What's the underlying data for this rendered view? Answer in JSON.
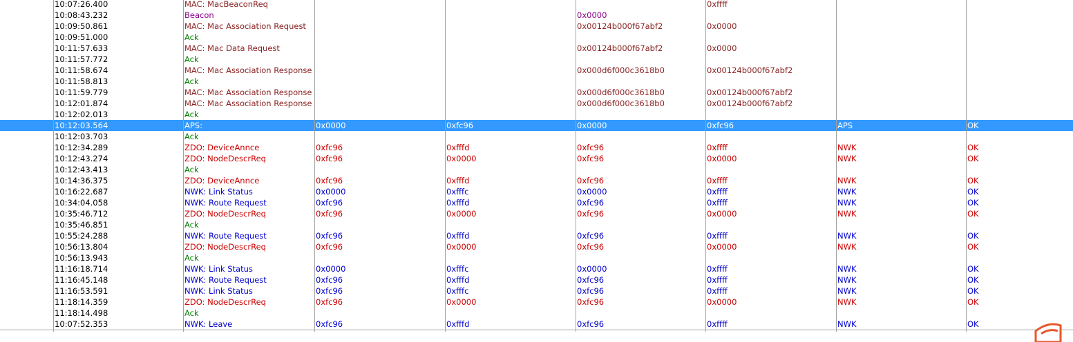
{
  "colors": {
    "MAC": "#8b2323",
    "Beacon": "#8b008b",
    "Ack": "#008000",
    "ZDO": "#cc0000",
    "NWK": "#0000cc",
    "APS": "#ffffff",
    "selected_bg": "#3399ff"
  },
  "rows": [
    {
      "time": "10:07:26.400",
      "type": "MAC",
      "desc": "MAC: MacBeaconReq",
      "src": "",
      "dst": "",
      "mac_src": "",
      "mac_dst": "0xffff",
      "layer": "",
      "status": ""
    },
    {
      "time": "10:08:43.232",
      "type": "Beacon",
      "desc": "Beacon",
      "src": "",
      "dst": "",
      "mac_src": "0x0000",
      "mac_dst": "",
      "layer": "",
      "status": ""
    },
    {
      "time": "10:09:50.861",
      "type": "MAC",
      "desc": "MAC: Mac Association Request",
      "src": "",
      "dst": "",
      "mac_src": "0x00124b000f67abf2",
      "mac_dst": "0x0000",
      "layer": "",
      "status": ""
    },
    {
      "time": "10:09:51.000",
      "type": "Ack",
      "desc": "Ack",
      "src": "",
      "dst": "",
      "mac_src": "",
      "mac_dst": "",
      "layer": "",
      "status": ""
    },
    {
      "time": "10:11:57.633",
      "type": "MAC",
      "desc": "MAC: Mac Data Request",
      "src": "",
      "dst": "",
      "mac_src": "0x00124b000f67abf2",
      "mac_dst": "0x0000",
      "layer": "",
      "status": ""
    },
    {
      "time": "10:11:57.772",
      "type": "Ack",
      "desc": "Ack",
      "src": "",
      "dst": "",
      "mac_src": "",
      "mac_dst": "",
      "layer": "",
      "status": ""
    },
    {
      "time": "10:11:58.674",
      "type": "MAC",
      "desc": "MAC: Mac Association Response",
      "src": "",
      "dst": "",
      "mac_src": "0x000d6f000c3618b0",
      "mac_dst": "0x00124b000f67abf2",
      "layer": "",
      "status": ""
    },
    {
      "time": "10:11:58.813",
      "type": "Ack",
      "desc": "Ack",
      "src": "",
      "dst": "",
      "mac_src": "",
      "mac_dst": "",
      "layer": "",
      "status": ""
    },
    {
      "time": "10:11:59.779",
      "type": "MAC",
      "desc": "MAC: Mac Association Response",
      "src": "",
      "dst": "",
      "mac_src": "0x000d6f000c3618b0",
      "mac_dst": "0x00124b000f67abf2",
      "layer": "",
      "status": ""
    },
    {
      "time": "10:12:01.874",
      "type": "MAC",
      "desc": "MAC: Mac Association Response",
      "src": "",
      "dst": "",
      "mac_src": "0x000d6f000c3618b0",
      "mac_dst": "0x00124b000f67abf2",
      "layer": "",
      "status": ""
    },
    {
      "time": "10:12:02.013",
      "type": "Ack",
      "desc": "Ack",
      "src": "",
      "dst": "",
      "mac_src": "",
      "mac_dst": "",
      "layer": "",
      "status": ""
    },
    {
      "time": "10:12:03.564",
      "type": "APS",
      "desc": "APS:",
      "src": "0x0000",
      "dst": "0xfc96",
      "mac_src": "0x0000",
      "mac_dst": "0xfc96",
      "layer": "APS",
      "status": "OK",
      "selected": true
    },
    {
      "time": "10:12:03.703",
      "type": "Ack",
      "desc": "Ack",
      "src": "",
      "dst": "",
      "mac_src": "",
      "mac_dst": "",
      "layer": "",
      "status": ""
    },
    {
      "time": "10:12:34.289",
      "type": "ZDO",
      "desc": "ZDO: DeviceAnnce",
      "src": "0xfc96",
      "dst": "0xfffd",
      "mac_src": "0xfc96",
      "mac_dst": "0xffff",
      "layer": "NWK",
      "status": "OK"
    },
    {
      "time": "10:12:43.274",
      "type": "ZDO",
      "desc": "ZDO: NodeDescrReq",
      "src": "0xfc96",
      "dst": "0x0000",
      "mac_src": "0xfc96",
      "mac_dst": "0x0000",
      "layer": "NWK",
      "status": "OK"
    },
    {
      "time": "10:12:43.413",
      "type": "Ack",
      "desc": "Ack",
      "src": "",
      "dst": "",
      "mac_src": "",
      "mac_dst": "",
      "layer": "",
      "status": ""
    },
    {
      "time": "10:14:36.375",
      "type": "ZDO",
      "desc": "ZDO: DeviceAnnce",
      "src": "0xfc96",
      "dst": "0xfffd",
      "mac_src": "0xfc96",
      "mac_dst": "0xffff",
      "layer": "NWK",
      "status": "OK"
    },
    {
      "time": "10:16:22.687",
      "type": "NWK",
      "desc": "NWK:  Link Status",
      "src": "0x0000",
      "dst": "0xfffc",
      "mac_src": "0x0000",
      "mac_dst": "0xffff",
      "layer": "NWK",
      "status": "OK"
    },
    {
      "time": "10:34:04.058",
      "type": "NWK",
      "desc": "NWK:  Route Request",
      "src": "0xfc96",
      "dst": "0xfffd",
      "mac_src": "0xfc96",
      "mac_dst": "0xffff",
      "layer": "NWK",
      "status": "OK"
    },
    {
      "time": "10:35:46.712",
      "type": "ZDO",
      "desc": "ZDO: NodeDescrReq",
      "src": "0xfc96",
      "dst": "0x0000",
      "mac_src": "0xfc96",
      "mac_dst": "0x0000",
      "layer": "NWK",
      "status": "OK"
    },
    {
      "time": "10:35:46.851",
      "type": "Ack",
      "desc": "Ack",
      "src": "",
      "dst": "",
      "mac_src": "",
      "mac_dst": "",
      "layer": "",
      "status": ""
    },
    {
      "time": "10:55:24.288",
      "type": "NWK",
      "desc": "NWK:  Route Request",
      "src": "0xfc96",
      "dst": "0xfffd",
      "mac_src": "0xfc96",
      "mac_dst": "0xffff",
      "layer": "NWK",
      "status": "OK"
    },
    {
      "time": "10:56:13.804",
      "type": "ZDO",
      "desc": "ZDO: NodeDescrReq",
      "src": "0xfc96",
      "dst": "0x0000",
      "mac_src": "0xfc96",
      "mac_dst": "0x0000",
      "layer": "NWK",
      "status": "OK"
    },
    {
      "time": "10:56:13.943",
      "type": "Ack",
      "desc": "Ack",
      "src": "",
      "dst": "",
      "mac_src": "",
      "mac_dst": "",
      "layer": "",
      "status": ""
    },
    {
      "time": "11:16:18.714",
      "type": "NWK",
      "desc": "NWK:  Link Status",
      "src": "0x0000",
      "dst": "0xfffc",
      "mac_src": "0x0000",
      "mac_dst": "0xffff",
      "layer": "NWK",
      "status": "OK"
    },
    {
      "time": "11:16:45.148",
      "type": "NWK",
      "desc": "NWK:  Route Request",
      "src": "0xfc96",
      "dst": "0xfffd",
      "mac_src": "0xfc96",
      "mac_dst": "0xffff",
      "layer": "NWK",
      "status": "OK"
    },
    {
      "time": "11:16:53.591",
      "type": "NWK",
      "desc": "NWK:  Link Status",
      "src": "0xfc96",
      "dst": "0xfffc",
      "mac_src": "0xfc96",
      "mac_dst": "0xffff",
      "layer": "NWK",
      "status": "OK"
    },
    {
      "time": "11:18:14.359",
      "type": "ZDO",
      "desc": "ZDO: NodeDescrReq",
      "src": "0xfc96",
      "dst": "0x0000",
      "mac_src": "0xfc96",
      "mac_dst": "0x0000",
      "layer": "NWK",
      "status": "OK"
    },
    {
      "time": "11:18:14.498",
      "type": "Ack",
      "desc": "Ack",
      "src": "",
      "dst": "",
      "mac_src": "",
      "mac_dst": "",
      "layer": "",
      "status": ""
    },
    {
      "time": "10:07:52.353",
      "type": "NWK",
      "desc": "NWK:  Leave",
      "src": "0xfc96",
      "dst": "0xfffd",
      "mac_src": "0xfc96",
      "mac_dst": "0xffff",
      "layer": "NWK",
      "status": "OK"
    }
  ],
  "corner_badge": {
    "icon": "app-logo-icon",
    "color": "#e8572a"
  }
}
